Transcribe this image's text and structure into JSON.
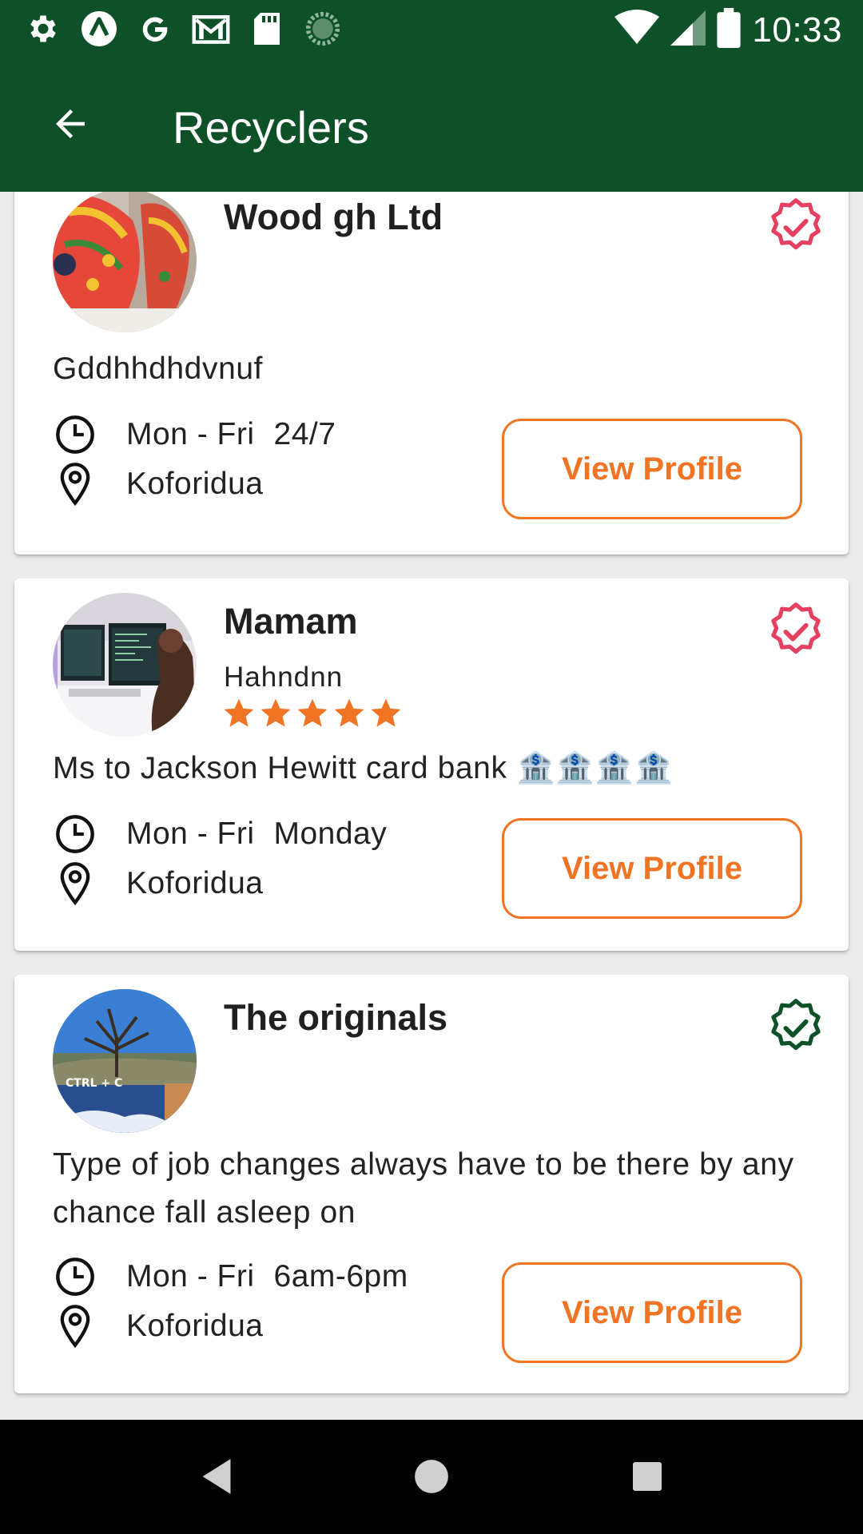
{
  "status_bar": {
    "time": "10:33",
    "left_icons": [
      "settings-icon",
      "arrow-circle-icon",
      "google-icon",
      "gmail-icon",
      "sd-card-icon",
      "loading-icon"
    ],
    "right_icons": [
      "wifi-icon",
      "signal-icon",
      "battery-icon"
    ]
  },
  "app_bar": {
    "title": "Recyclers",
    "back_icon": "back-arrow-icon",
    "color": "#0e5128"
  },
  "recyclers": [
    {
      "name": "Wood gh Ltd",
      "subtitle": "",
      "description": "Gddhhdhdvnuf",
      "days": "Mon - Fri",
      "hours": "24/7",
      "location": "Koforidua",
      "button": "View Profile",
      "verified_color": "#e5405f",
      "rating": null
    },
    {
      "name": "Mamam",
      "subtitle": "Hahndnn",
      "description": "Ms to Jackson Hewitt card bank 🏦🏦🏦🏦",
      "days": "Mon - Fri",
      "hours": "Monday",
      "location": "Koforidua",
      "button": "View Profile",
      "verified_color": "#e5405f",
      "rating": 5
    },
    {
      "name": "The originals",
      "subtitle": "",
      "description": "Type of job changes always have to be there by any chance fall asleep on",
      "days": "Mon - Fri",
      "hours": "6am-6pm",
      "location": "Koforidua",
      "button": "View Profile",
      "verified_color": "#0e5128",
      "rating": null
    }
  ],
  "accent_color": "#f07423",
  "nav_bar": {
    "icons": [
      "nav-back-icon",
      "nav-home-icon",
      "nav-recents-icon"
    ]
  }
}
